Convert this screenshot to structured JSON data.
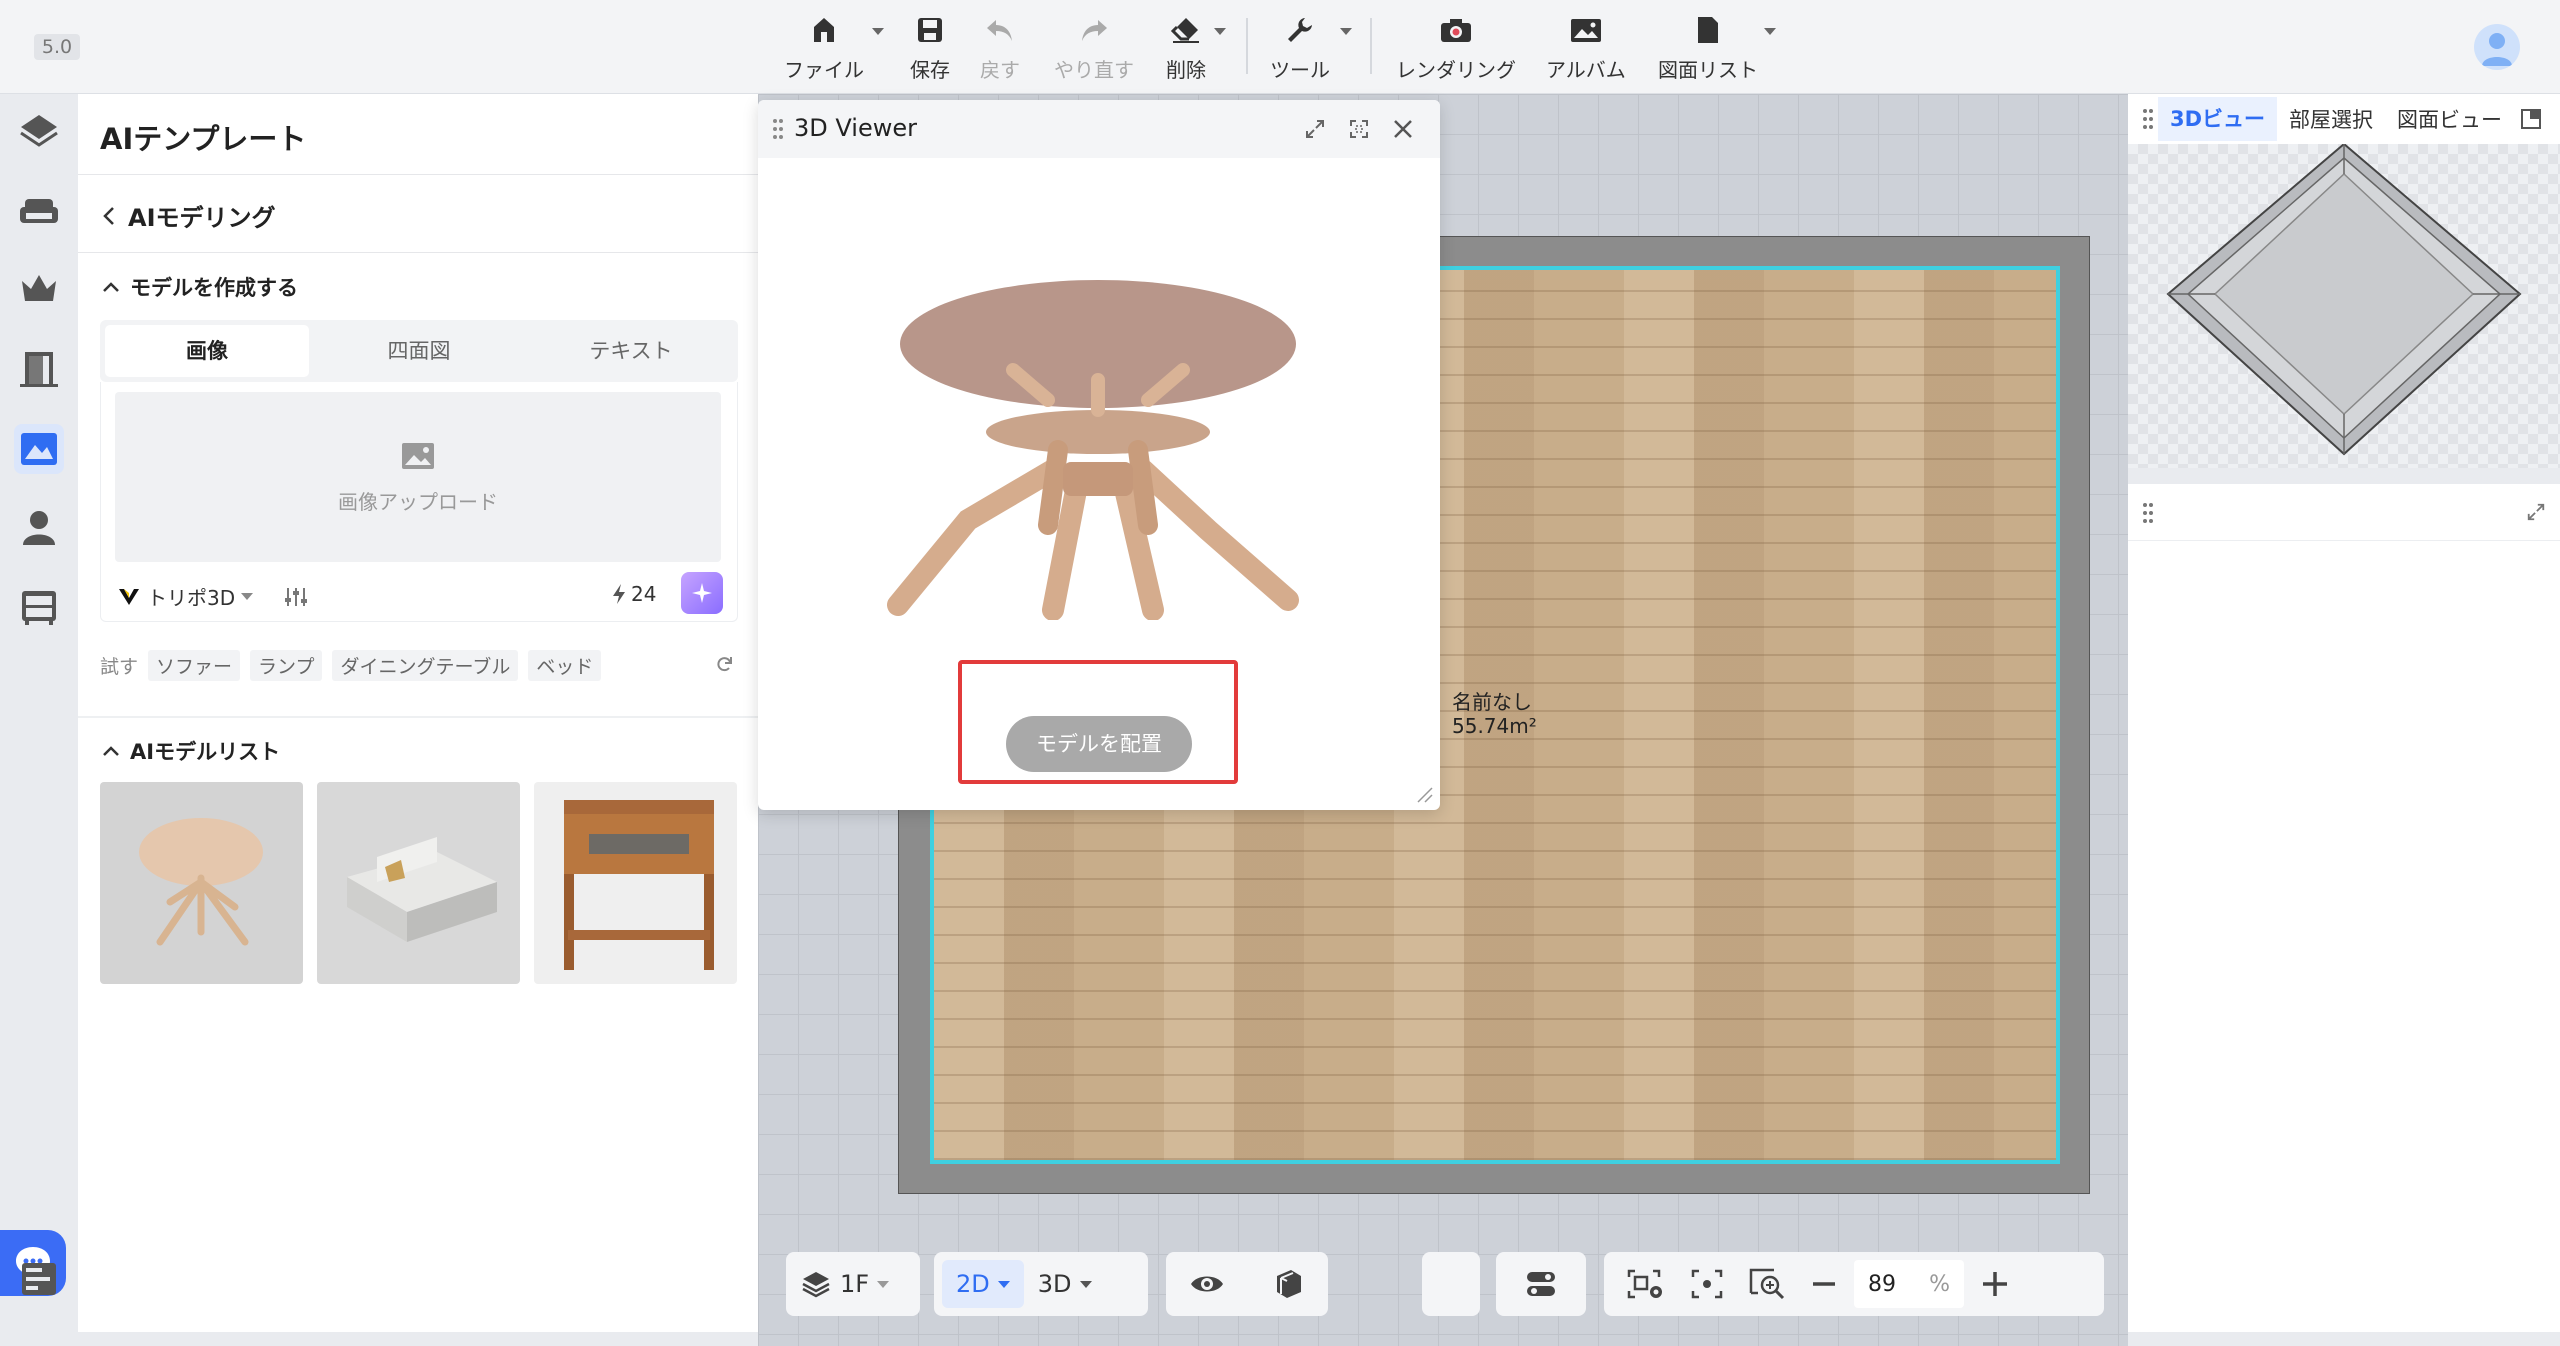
{
  "app": {
    "version": "5.0"
  },
  "toolbar": {
    "file": "ファイル",
    "save": "保存",
    "undo": "戻す",
    "redo": "やり直す",
    "delete": "削除",
    "tools": "ツール",
    "render": "レンダリング",
    "album": "アルバム",
    "drawing_list": "図面リスト"
  },
  "panel": {
    "title": "AIテンプレート",
    "back_label": "AIモデリング",
    "create_section": "モデルを作成する",
    "tabs": [
      "画像",
      "四面図",
      "テキスト"
    ],
    "upload_label": "画像アップロード",
    "engine": "トリポ3D",
    "credits": "24",
    "try_label": "試す",
    "try_chips": [
      "ソファー",
      "ランプ",
      "ダイニングテーブル",
      "ベッド"
    ],
    "model_list_section": "AIモデルリスト"
  },
  "viewer": {
    "title": "3D Viewer",
    "place_button": "モデルを配置"
  },
  "room": {
    "name": "名前なし",
    "area": "55.74m²"
  },
  "bottom_bar": {
    "floor": "1F",
    "view_2d": "2D",
    "view_3d": "3D",
    "zoom_value": "89",
    "zoom_unit": "%"
  },
  "right_panel": {
    "tabs": [
      "3Dビュー",
      "部屋選択",
      "図面ビュー"
    ]
  },
  "colors": {
    "accent": "#2f6df2",
    "highlight": "#e23b3b",
    "room_outline": "#3fd0e0"
  }
}
